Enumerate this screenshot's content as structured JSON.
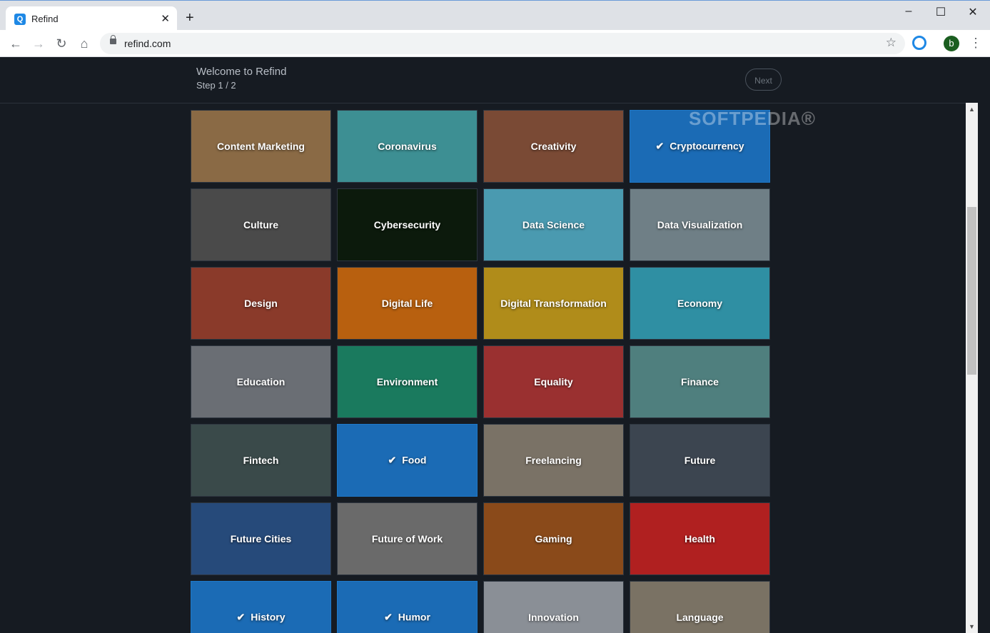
{
  "browser": {
    "tab_title": "Refind",
    "tab_favicon": "refind-icon",
    "new_tab_symbol": "+",
    "close_tab_symbol": "✕",
    "url": "refind.com",
    "profile_initial": "b",
    "window_controls": [
      "–",
      "☐",
      "✕"
    ]
  },
  "header": {
    "welcome": "Welcome to Refind",
    "step": "Step 1 / 2",
    "next_label": "Next"
  },
  "watermark": "SOFTPEDIA®",
  "topics": [
    {
      "label": "Content Marketing",
      "selected": false,
      "color": "#8a6a45"
    },
    {
      "label": "Coronavirus",
      "selected": false,
      "color": "#3d8f93"
    },
    {
      "label": "Creativity",
      "selected": false,
      "color": "#7a4a35"
    },
    {
      "label": "Cryptocurrency",
      "selected": true,
      "color": "#1b6bb5"
    },
    {
      "label": "Culture",
      "selected": false,
      "color": "#4a4a4a"
    },
    {
      "label": "Cybersecurity",
      "selected": false,
      "color": "#0c1a0c"
    },
    {
      "label": "Data Science",
      "selected": false,
      "color": "#4a9ab0"
    },
    {
      "label": "Data Visualization",
      "selected": false,
      "color": "#6f7f86"
    },
    {
      "label": "Design",
      "selected": false,
      "color": "#8a3a2a"
    },
    {
      "label": "Digital Life",
      "selected": false,
      "color": "#b8600f"
    },
    {
      "label": "Digital Transformation",
      "selected": false,
      "color": "#b08c1a"
    },
    {
      "label": "Economy",
      "selected": false,
      "color": "#2f8fa3"
    },
    {
      "label": "Education",
      "selected": false,
      "color": "#6a6e74"
    },
    {
      "label": "Environment",
      "selected": false,
      "color": "#1a7a5e"
    },
    {
      "label": "Equality",
      "selected": false,
      "color": "#9a3030"
    },
    {
      "label": "Finance",
      "selected": false,
      "color": "#4f7f7e"
    },
    {
      "label": "Fintech",
      "selected": false,
      "color": "#3a4a4a"
    },
    {
      "label": "Food",
      "selected": true,
      "color": "#1b6bb5"
    },
    {
      "label": "Freelancing",
      "selected": false,
      "color": "#7a7266"
    },
    {
      "label": "Future",
      "selected": false,
      "color": "#3c4550"
    },
    {
      "label": "Future Cities",
      "selected": false,
      "color": "#264a7a"
    },
    {
      "label": "Future of Work",
      "selected": false,
      "color": "#6a6a6a"
    },
    {
      "label": "Gaming",
      "selected": false,
      "color": "#8a4a1a"
    },
    {
      "label": "Health",
      "selected": false,
      "color": "#b02020"
    },
    {
      "label": "History",
      "selected": true,
      "color": "#1b6bb5"
    },
    {
      "label": "Humor",
      "selected": true,
      "color": "#1b6bb5"
    },
    {
      "label": "Innovation",
      "selected": false,
      "color": "#8a8f96"
    },
    {
      "label": "Language",
      "selected": false,
      "color": "#7a7264"
    }
  ]
}
